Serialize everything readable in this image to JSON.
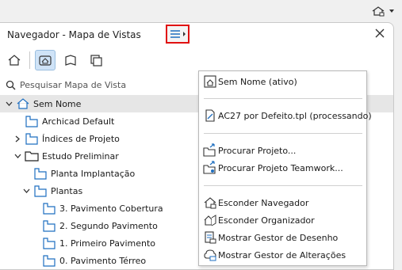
{
  "panel": {
    "title": "Navegador - Mapa de Vistas",
    "search_placeholder": "Pesquisar Mapa de Vista"
  },
  "tabs": [
    {
      "name": "project-map",
      "active": false
    },
    {
      "name": "view-map",
      "active": true
    },
    {
      "name": "layout-book",
      "active": false
    },
    {
      "name": "publisher-sets",
      "active": false
    }
  ],
  "tree": [
    {
      "label": "Sem Nome",
      "level": 0,
      "expand": "open",
      "icon": "project-icon",
      "selected": true
    },
    {
      "label": "Archicad Default",
      "level": 1,
      "expand": "",
      "icon": "folder-view-icon"
    },
    {
      "label": "Índices de Projeto",
      "level": 1,
      "expand": "closed",
      "icon": "folder-view-icon"
    },
    {
      "label": "Estudo Preliminar",
      "level": 1,
      "expand": "open",
      "icon": "folder-icon"
    },
    {
      "label": "Planta Implantação",
      "level": 2,
      "expand": "",
      "icon": "folder-view-icon"
    },
    {
      "label": "Plantas",
      "level": 2,
      "expand": "open",
      "icon": "folder-view-icon"
    },
    {
      "label": "3. Pavimento Cobertura",
      "level": 3,
      "expand": "",
      "icon": "folder-view-icon"
    },
    {
      "label": "2. Segundo Pavimento",
      "level": 3,
      "expand": "",
      "icon": "folder-view-icon"
    },
    {
      "label": "1. Primeiro Pavimento",
      "level": 3,
      "expand": "",
      "icon": "folder-view-icon"
    },
    {
      "label": "0. Pavimento Térreo",
      "level": 3,
      "expand": "",
      "icon": "folder-view-icon"
    }
  ],
  "menu": {
    "groups": [
      [
        {
          "label": "Sem Nome (ativo)",
          "icon": "project-active-icon"
        }
      ],
      [
        {
          "label": "AC27 por Defeito.tpl (processando)",
          "icon": "template-icon"
        }
      ],
      [
        {
          "label": "Procurar Projeto...",
          "icon": "browse-project-icon"
        },
        {
          "label": "Procurar Projeto Teamwork...",
          "icon": "browse-teamwork-icon"
        }
      ],
      [
        {
          "label": "Esconder Navegador",
          "icon": "hide-navigator-icon"
        },
        {
          "label": "Esconder Organizador",
          "icon": "hide-organizer-icon"
        },
        {
          "label": "Mostrar Gestor de Desenho",
          "icon": "drawing-manager-icon"
        },
        {
          "label": "Mostrar Gestor de Alterações",
          "icon": "change-manager-icon"
        }
      ]
    ]
  },
  "colors": {
    "accent": "#1f6fc0",
    "highlight_border": "#e01010",
    "selected_row": "#e6e6e6",
    "active_tab": "#cfe3f7"
  }
}
